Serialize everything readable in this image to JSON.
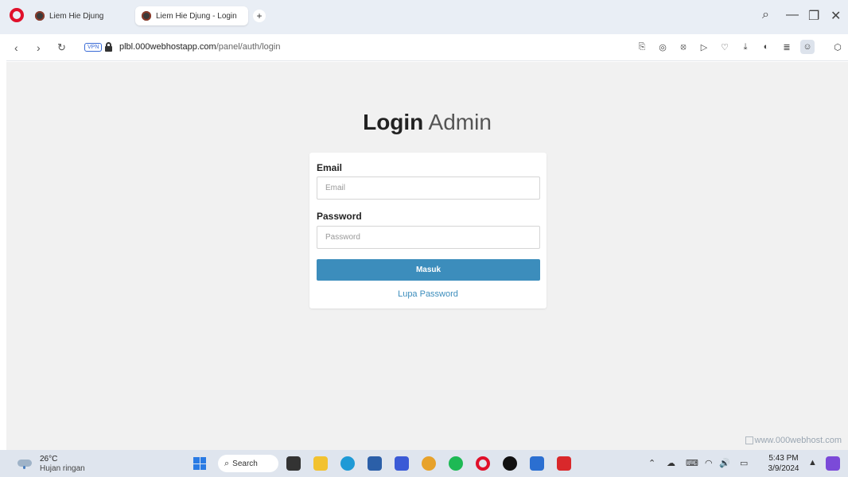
{
  "browser": {
    "tabs": [
      {
        "label": "Liem Hie Djung",
        "active": false
      },
      {
        "label": "Liem Hie Djung - Login",
        "active": true
      }
    ],
    "new_tab_glyph": "+",
    "vpn_label": "VPN",
    "url_host": "plbl.000webhostapp.com",
    "url_path": "/panel/auth/login",
    "window_controls": {
      "search": "search-icon",
      "minimize": "minimize-icon",
      "restore": "restore-icon",
      "close": "close-icon"
    },
    "toolbar_icons": [
      "snapshot-icon",
      "camera-icon",
      "shield-icon",
      "send-icon",
      "heart-icon",
      "download-icon",
      "sidebar-icon",
      "menu-icon",
      "profile-icon",
      "extensions-icon"
    ],
    "accent_color": "#5b2ee6"
  },
  "page": {
    "title_bold": "Login",
    "title_light": "Admin",
    "form": {
      "email_label": "Email",
      "email_placeholder": "Email",
      "password_label": "Password",
      "password_placeholder": "Password",
      "submit_label": "Masuk",
      "forgot_link": "Lupa Password"
    },
    "watermark": "www.000webhost.com",
    "primary_color": "#3c8dbc"
  },
  "taskbar": {
    "temperature": "26°C",
    "weather": "Hujan ringan",
    "search_label": "Search",
    "apps": [
      "task-view-icon",
      "file-explorer-icon",
      "edge-icon",
      "store-icon",
      "app-icon",
      "chrome-icon",
      "spotify-icon",
      "opera-icon",
      "tiktok-icon",
      "word-icon",
      "acrobat-icon"
    ],
    "time": "5:43 PM",
    "date": "3/9/2024"
  }
}
